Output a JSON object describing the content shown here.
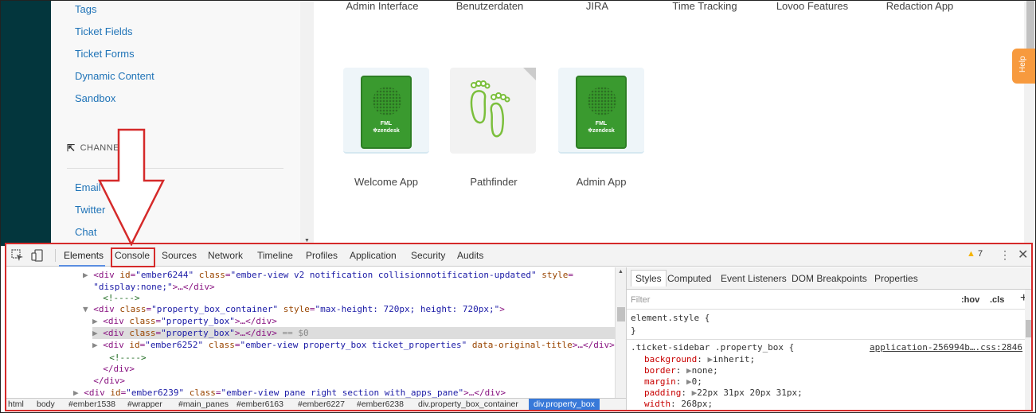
{
  "left_nav": {
    "links": [
      "Tags",
      "Ticket Fields",
      "Ticket Forms",
      "Dynamic Content",
      "Sandbox"
    ],
    "section_title": "CHANNE",
    "channel_links": [
      "Email",
      "Twitter",
      "Chat"
    ]
  },
  "main": {
    "top_apps": [
      "Admin Interface",
      "Benutzerdaten",
      "JIRA",
      "Time Tracking",
      "Lovoo Features",
      "Redaction App"
    ],
    "apps": [
      {
        "name": "Welcome App",
        "icon": "zendesk-phone-icon",
        "brand": "zendesk"
      },
      {
        "name": "Pathfinder",
        "icon": "footprints-icon"
      },
      {
        "name": "Admin App",
        "icon": "zendesk-phone-icon",
        "brand": "zendesk"
      }
    ],
    "help_label": "Help"
  },
  "devtools": {
    "tabs": [
      "Elements",
      "Console",
      "Sources",
      "Network",
      "Timeline",
      "Profiles",
      "Application",
      "Security",
      "Audits"
    ],
    "active_tab": "Elements",
    "warning_count": "7",
    "dom_lines": [
      {
        "indent": "   ",
        "arrow": "▶",
        "open": "<div ",
        "attrs": [
          [
            "id",
            "\"ember6244\""
          ],
          [
            "class",
            "\"ember-view v2 notification collisionnotification-updated\""
          ],
          [
            "style",
            "="
          ]
        ],
        "tail": ""
      },
      {
        "indent": "   ",
        "arrow": " ",
        "open": "",
        "attrs": [],
        "tail": "\"display:none;\">…</div>"
      },
      {
        "indent": "     ",
        "arrow": " ",
        "open": "",
        "attrs": [],
        "tail": "<!---->"
      },
      {
        "indent": "   ",
        "arrow": "▼",
        "open": "<div ",
        "attrs": [
          [
            "class",
            "\"property_box_container\""
          ],
          [
            "style",
            "\"max-height: 720px; height: 720px;\""
          ]
        ],
        "tail": ">"
      },
      {
        "indent": "     ",
        "arrow": "▶",
        "open": "<div ",
        "attrs": [
          [
            "class",
            "\"property_box\""
          ]
        ],
        "tail": ">…</div>"
      },
      {
        "indent": "     ",
        "arrow": "▶",
        "open": "<div ",
        "attrs": [
          [
            "class",
            "\"property_box\""
          ]
        ],
        "tail": ">…</div> == $0"
      },
      {
        "indent": "     ",
        "arrow": "▶",
        "open": "<div ",
        "attrs": [
          [
            "id",
            "\"ember6252\""
          ],
          [
            "class",
            "\"ember-view property_box ticket_properties\""
          ],
          [
            "data-original-title",
            ""
          ]
        ],
        "tail": ">…</div>"
      },
      {
        "indent": "       ",
        "arrow": " ",
        "open": "",
        "attrs": [],
        "tail": "<!---->"
      },
      {
        "indent": "     ",
        "arrow": " ",
        "open": "",
        "attrs": [],
        "tail": "</div>"
      },
      {
        "indent": "   ",
        "arrow": " ",
        "open": "",
        "attrs": [],
        "tail": "</div>"
      },
      {
        "indent": " ",
        "arrow": "▶",
        "open": "<div ",
        "attrs": [
          [
            "id",
            "\"ember6239\""
          ],
          [
            "class",
            "\"ember-view pane right section with_apps_pane\""
          ]
        ],
        "tail": ">…</div>"
      }
    ],
    "selected_line": 5,
    "breadcrumbs": [
      "html",
      "body",
      "#ember1538",
      "#wrapper",
      "#main_panes",
      "#ember6163",
      "#ember6227",
      "#ember6238",
      "div.property_box_container",
      "div.property_box"
    ],
    "styles_tabs": [
      "Styles",
      "Computed",
      "Event Listeners",
      "DOM Breakpoints",
      "Properties"
    ],
    "filter_placeholder": "Filter",
    "hov": ":hov",
    "cls": ".cls",
    "element_style": {
      "selector": "element.style {",
      "close": "}"
    },
    "rule": {
      "selector": ".ticket-sidebar .property_box {",
      "source": "application-256994b….css:2846",
      "declarations": [
        {
          "prop": "background",
          "value": "inherit;",
          "expand": true
        },
        {
          "prop": "border",
          "value": "none;",
          "expand": true
        },
        {
          "prop": "margin",
          "value": "0;",
          "expand": true
        },
        {
          "prop": "padding",
          "value": "22px 31px 20px 31px;",
          "expand": true
        },
        {
          "prop": "width",
          "value": "268px;",
          "expand": false
        }
      ]
    }
  }
}
